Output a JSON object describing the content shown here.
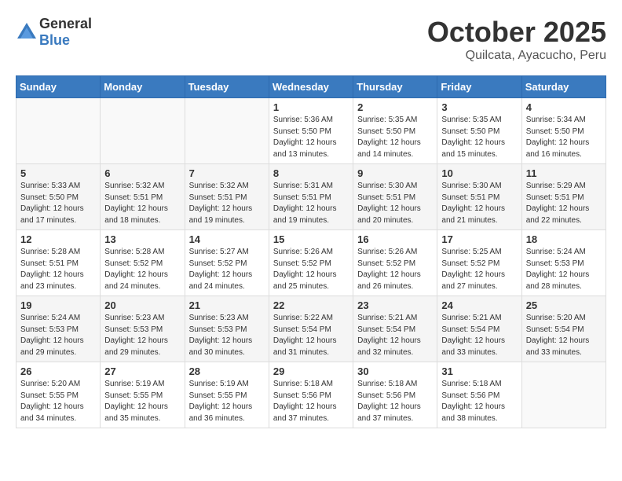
{
  "logo": {
    "general": "General",
    "blue": "Blue"
  },
  "title": "October 2025",
  "location": "Quilcata, Ayacucho, Peru",
  "days_of_week": [
    "Sunday",
    "Monday",
    "Tuesday",
    "Wednesday",
    "Thursday",
    "Friday",
    "Saturday"
  ],
  "weeks": [
    [
      {
        "day": "",
        "info": ""
      },
      {
        "day": "",
        "info": ""
      },
      {
        "day": "",
        "info": ""
      },
      {
        "day": "1",
        "info": "Sunrise: 5:36 AM\nSunset: 5:50 PM\nDaylight: 12 hours and 13 minutes."
      },
      {
        "day": "2",
        "info": "Sunrise: 5:35 AM\nSunset: 5:50 PM\nDaylight: 12 hours and 14 minutes."
      },
      {
        "day": "3",
        "info": "Sunrise: 5:35 AM\nSunset: 5:50 PM\nDaylight: 12 hours and 15 minutes."
      },
      {
        "day": "4",
        "info": "Sunrise: 5:34 AM\nSunset: 5:50 PM\nDaylight: 12 hours and 16 minutes."
      }
    ],
    [
      {
        "day": "5",
        "info": "Sunrise: 5:33 AM\nSunset: 5:50 PM\nDaylight: 12 hours and 17 minutes."
      },
      {
        "day": "6",
        "info": "Sunrise: 5:32 AM\nSunset: 5:51 PM\nDaylight: 12 hours and 18 minutes."
      },
      {
        "day": "7",
        "info": "Sunrise: 5:32 AM\nSunset: 5:51 PM\nDaylight: 12 hours and 19 minutes."
      },
      {
        "day": "8",
        "info": "Sunrise: 5:31 AM\nSunset: 5:51 PM\nDaylight: 12 hours and 19 minutes."
      },
      {
        "day": "9",
        "info": "Sunrise: 5:30 AM\nSunset: 5:51 PM\nDaylight: 12 hours and 20 minutes."
      },
      {
        "day": "10",
        "info": "Sunrise: 5:30 AM\nSunset: 5:51 PM\nDaylight: 12 hours and 21 minutes."
      },
      {
        "day": "11",
        "info": "Sunrise: 5:29 AM\nSunset: 5:51 PM\nDaylight: 12 hours and 22 minutes."
      }
    ],
    [
      {
        "day": "12",
        "info": "Sunrise: 5:28 AM\nSunset: 5:51 PM\nDaylight: 12 hours and 23 minutes."
      },
      {
        "day": "13",
        "info": "Sunrise: 5:28 AM\nSunset: 5:52 PM\nDaylight: 12 hours and 24 minutes."
      },
      {
        "day": "14",
        "info": "Sunrise: 5:27 AM\nSunset: 5:52 PM\nDaylight: 12 hours and 24 minutes."
      },
      {
        "day": "15",
        "info": "Sunrise: 5:26 AM\nSunset: 5:52 PM\nDaylight: 12 hours and 25 minutes."
      },
      {
        "day": "16",
        "info": "Sunrise: 5:26 AM\nSunset: 5:52 PM\nDaylight: 12 hours and 26 minutes."
      },
      {
        "day": "17",
        "info": "Sunrise: 5:25 AM\nSunset: 5:52 PM\nDaylight: 12 hours and 27 minutes."
      },
      {
        "day": "18",
        "info": "Sunrise: 5:24 AM\nSunset: 5:53 PM\nDaylight: 12 hours and 28 minutes."
      }
    ],
    [
      {
        "day": "19",
        "info": "Sunrise: 5:24 AM\nSunset: 5:53 PM\nDaylight: 12 hours and 29 minutes."
      },
      {
        "day": "20",
        "info": "Sunrise: 5:23 AM\nSunset: 5:53 PM\nDaylight: 12 hours and 29 minutes."
      },
      {
        "day": "21",
        "info": "Sunrise: 5:23 AM\nSunset: 5:53 PM\nDaylight: 12 hours and 30 minutes."
      },
      {
        "day": "22",
        "info": "Sunrise: 5:22 AM\nSunset: 5:54 PM\nDaylight: 12 hours and 31 minutes."
      },
      {
        "day": "23",
        "info": "Sunrise: 5:21 AM\nSunset: 5:54 PM\nDaylight: 12 hours and 32 minutes."
      },
      {
        "day": "24",
        "info": "Sunrise: 5:21 AM\nSunset: 5:54 PM\nDaylight: 12 hours and 33 minutes."
      },
      {
        "day": "25",
        "info": "Sunrise: 5:20 AM\nSunset: 5:54 PM\nDaylight: 12 hours and 33 minutes."
      }
    ],
    [
      {
        "day": "26",
        "info": "Sunrise: 5:20 AM\nSunset: 5:55 PM\nDaylight: 12 hours and 34 minutes."
      },
      {
        "day": "27",
        "info": "Sunrise: 5:19 AM\nSunset: 5:55 PM\nDaylight: 12 hours and 35 minutes."
      },
      {
        "day": "28",
        "info": "Sunrise: 5:19 AM\nSunset: 5:55 PM\nDaylight: 12 hours and 36 minutes."
      },
      {
        "day": "29",
        "info": "Sunrise: 5:18 AM\nSunset: 5:56 PM\nDaylight: 12 hours and 37 minutes."
      },
      {
        "day": "30",
        "info": "Sunrise: 5:18 AM\nSunset: 5:56 PM\nDaylight: 12 hours and 37 minutes."
      },
      {
        "day": "31",
        "info": "Sunrise: 5:18 AM\nSunset: 5:56 PM\nDaylight: 12 hours and 38 minutes."
      },
      {
        "day": "",
        "info": ""
      }
    ]
  ]
}
